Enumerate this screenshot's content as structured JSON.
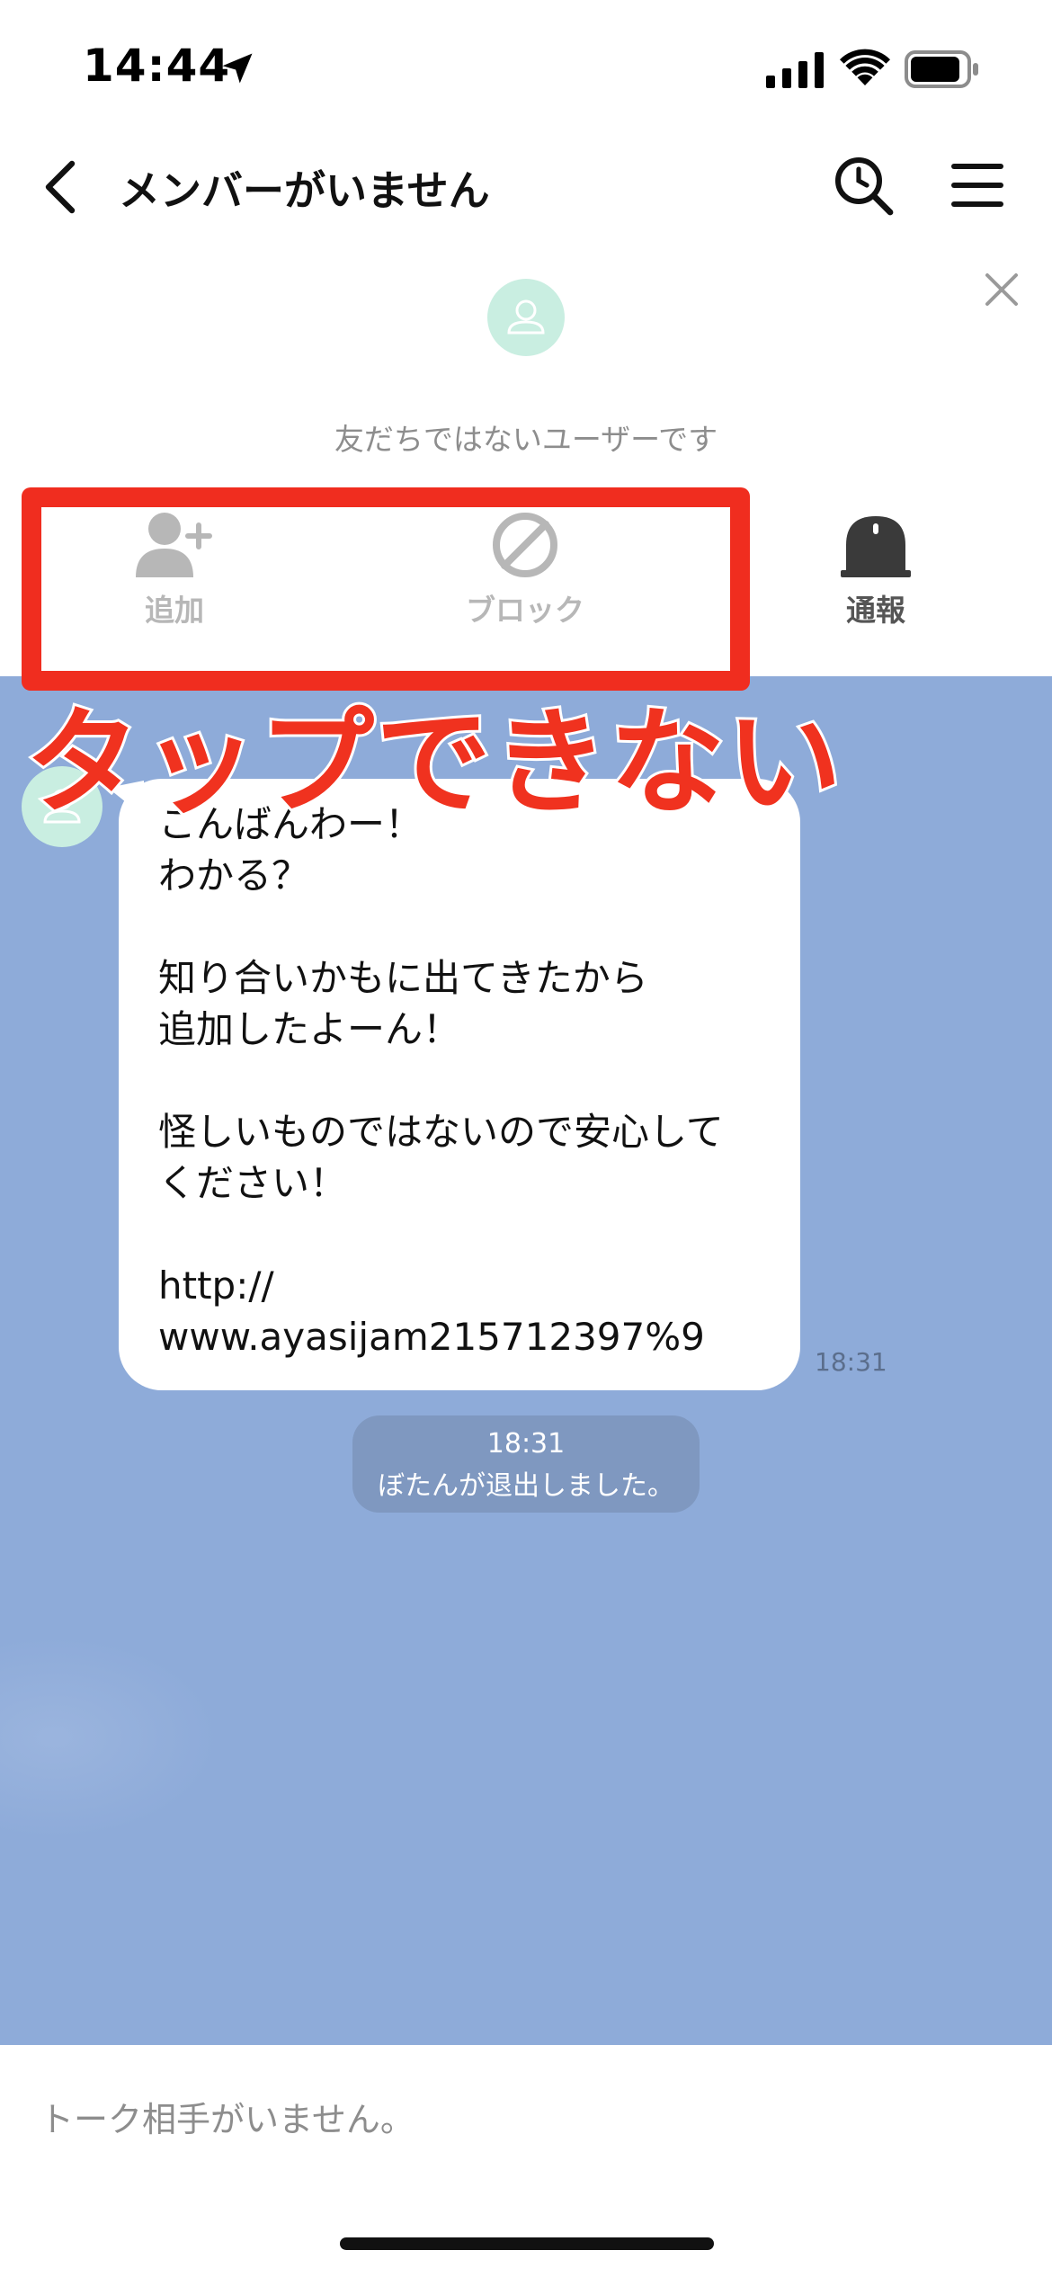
{
  "status_bar": {
    "time": "14:44"
  },
  "header": {
    "title": "メンバーがいません"
  },
  "banner": {
    "message": "友だちではないユーザーです",
    "actions": [
      {
        "label": "追加",
        "icon": "add-friend-icon"
      },
      {
        "label": "ブロック",
        "icon": "block-icon"
      },
      {
        "label": "通報",
        "icon": "report-icon"
      }
    ]
  },
  "annotation": {
    "caption": "タップできない",
    "frame_color": "#f02d1f"
  },
  "chat": {
    "message": "こんばんわー！\nわかる？\n\n知り合いかもに出てきたから\n追加したよーん！\n\n怪しいものではないので安心して\nください！\n\nhttp://\nwww.ayasijam215712397%9",
    "message_time": "18:31",
    "system": {
      "time": "18:31",
      "text": "ぼたんが退出しました。"
    }
  },
  "footer": {
    "text": "トーク相手がいません。"
  },
  "colors": {
    "chat_background": "#8eabd9",
    "accent_red": "#f02d1f",
    "avatar": "#c9eee1"
  }
}
